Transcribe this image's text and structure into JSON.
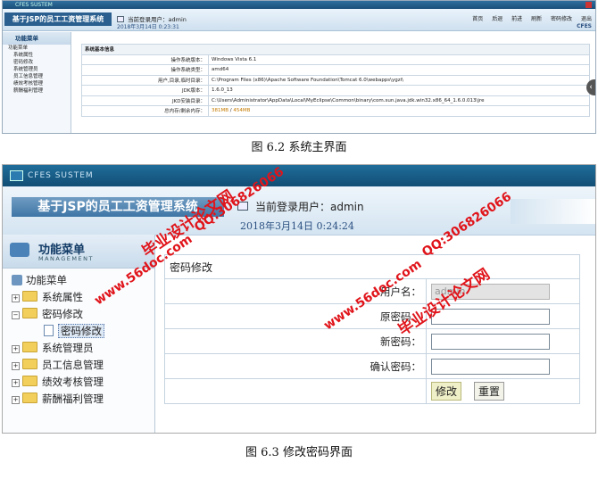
{
  "figure1": {
    "caption": "图 6.2 系统主界面",
    "window_title": "CFES SUSTEM",
    "system_title": "基于JSP的员工工资管理系统",
    "current_user_label": "当前登录用户：admin",
    "datetime": "2018年3月14日   0:23:31",
    "brand": "CFES",
    "nav": [
      "首页",
      "后退",
      "前进",
      "刷新",
      "密码修改",
      "退出"
    ],
    "menu_header": "功能菜单",
    "menu_root": "功能菜单",
    "menu_items": [
      "系统属性",
      "密码修改",
      "系统管理员",
      "员工信息管理",
      "绩效考核管理",
      "薪酬福利管理"
    ],
    "info_title": "系统基本信息",
    "info_rows": [
      {
        "label": "操作系统版本：",
        "value": "Windows Vista  6.1"
      },
      {
        "label": "操作系统类型：",
        "value": "amd64"
      },
      {
        "label": "用户,目录,临时目录：",
        "value": "C:\\Program Files (x86)\\Apache Software Foundation\\Tomcat 6.0\\webapps\\ygzi\\"
      },
      {
        "label": "JDK版本：",
        "value": "1.6.0_13"
      },
      {
        "label": "JKD安装目录：",
        "value": "C:\\Users\\Administrator\\AppData\\Local\\MyEclipse\\Common\\binary\\com.sun.java.jdk.win32.x86_64_1.6.0.013\\jre"
      }
    ],
    "memory_label": "总内存/剩余内存：",
    "memory_total": "381MB",
    "memory_sep": " / ",
    "memory_free": "454MB"
  },
  "figure2": {
    "caption": "图 6.3  修改密码界面",
    "window_title": "CFES SUSTEM",
    "system_title": "基于JSP的员工工资管理系统",
    "current_user_label": "当前登录用户：admin",
    "datetime": "2018年3月14日   0:24:24",
    "menu_header": "功能菜单",
    "menu_header_en": "MANAGEMENT",
    "menu_root": "功能菜单",
    "menu_items": [
      {
        "label": "系统属性",
        "expanded": false
      },
      {
        "label": "密码修改",
        "expanded": true,
        "children": [
          "密码修改"
        ]
      },
      {
        "label": "系统管理员",
        "expanded": false
      },
      {
        "label": "员工信息管理",
        "expanded": false
      },
      {
        "label": "绩效考核管理",
        "expanded": false
      },
      {
        "label": "薪酬福利管理",
        "expanded": false
      }
    ],
    "form_title": "密码修改",
    "username_label": "用户名：",
    "username_value": "admin",
    "old_password_label": "原密码：",
    "new_password_label": "新密码：",
    "confirm_password_label": "确认密码：",
    "modify_button": "修改",
    "reset_button": "重置"
  },
  "watermarks": [
    "毕业设计论文网",
    "www.56doc.com",
    "QQ:306826066",
    "毕业设计论文网",
    "www.56doc.com",
    "QQ:306826066"
  ]
}
